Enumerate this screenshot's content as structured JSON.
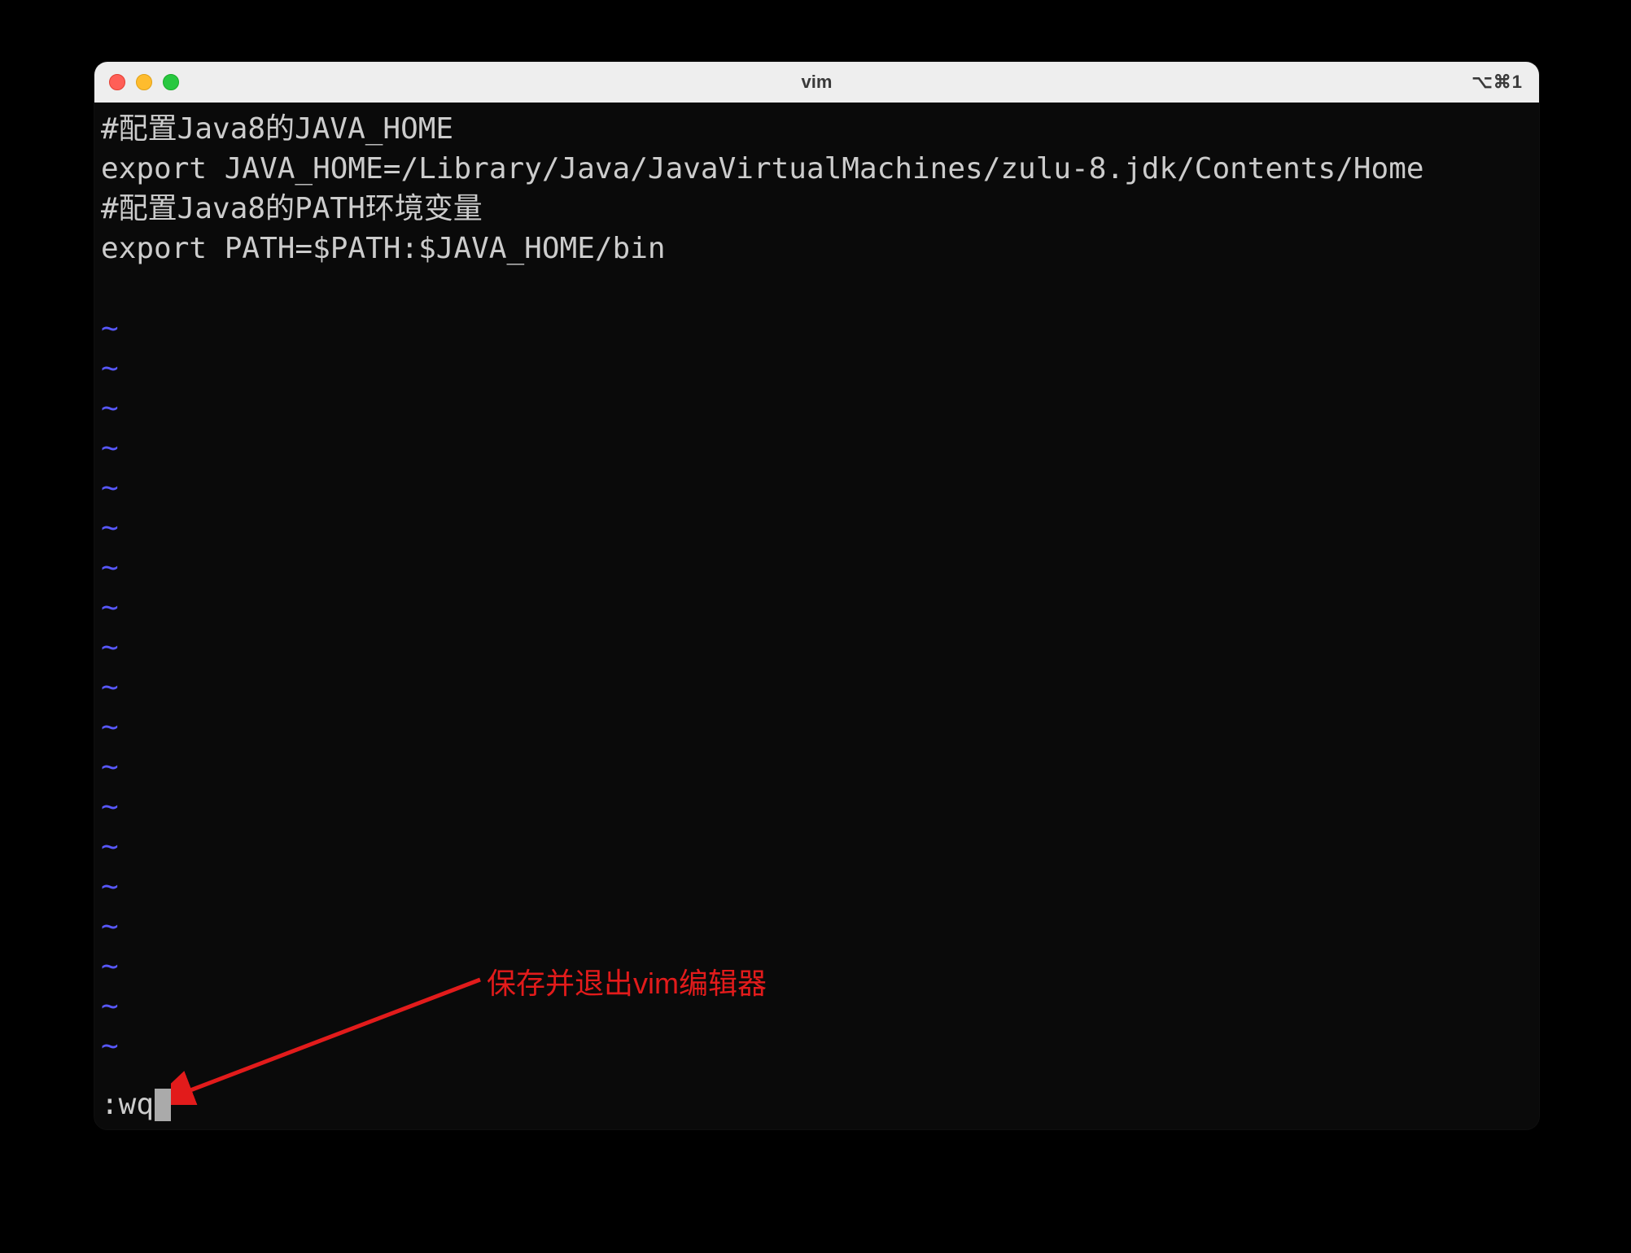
{
  "window": {
    "title": "vim",
    "shortcut": "⌥⌘1"
  },
  "file": {
    "lines": [
      "#配置Java8的JAVA_HOME",
      "export JAVA_HOME=/Library/Java/JavaVirtualMachines/zulu-8.jdk/Contents/Home",
      "#配置Java8的PATH环境变量",
      "export PATH=$PATH:$JAVA_HOME/bin"
    ]
  },
  "tilde": "~",
  "command": ":wq",
  "annotation": {
    "text": "保存并退出vim编辑器"
  }
}
